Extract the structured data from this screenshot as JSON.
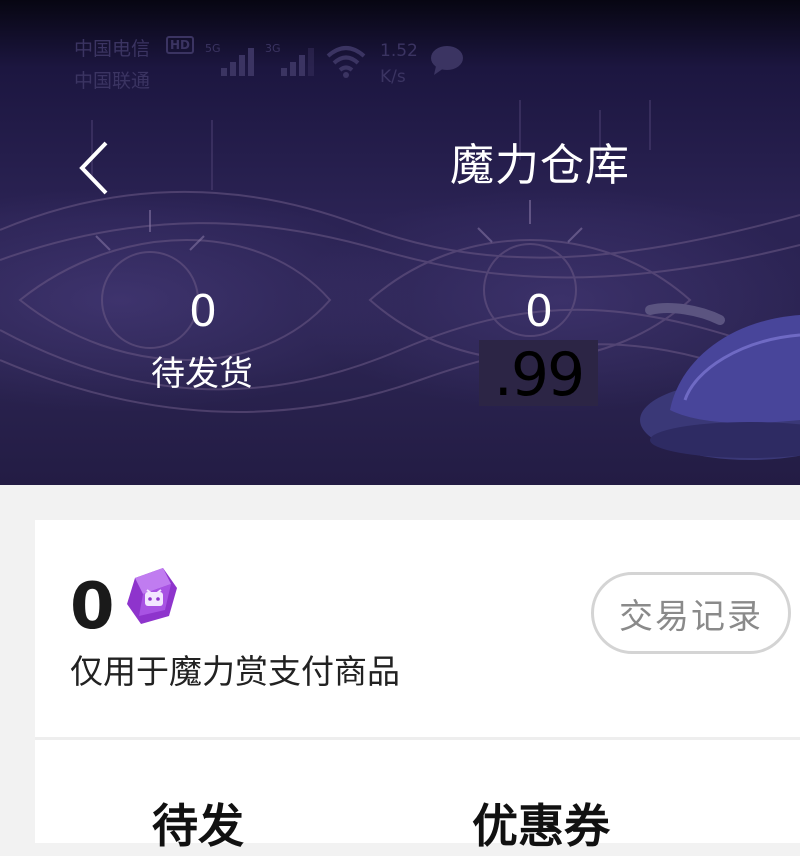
{
  "status_bar": {
    "carrier_1": "中国电信",
    "hd_badge": "HD",
    "carrier_2": "中国联通",
    "signal_1_label": "5G",
    "signal_2_label": "3G",
    "speed_value": "1.52",
    "speed_unit": "K/s",
    "icons": [
      "signal-icon",
      "signal-icon",
      "wifi-icon",
      "chat-bubble-icon"
    ]
  },
  "header": {
    "title": "魔力仓库",
    "back_icon": "chevron-left-icon"
  },
  "stats": {
    "pending_count": "0",
    "pending_label": "待发货",
    "second_count": "0",
    "second_value": ".99"
  },
  "card": {
    "balance": "0",
    "currency_icon": "gem-icon",
    "balance_desc": "仅用于魔力赏支付商品",
    "transactions_button": "交易记录"
  },
  "tabs": [
    {
      "label": "待发"
    },
    {
      "label": "优惠券"
    }
  ],
  "colors": {
    "header_bg": "#2a2350",
    "page_bg": "#f2f2f2",
    "gem": "#9b3fd6"
  }
}
